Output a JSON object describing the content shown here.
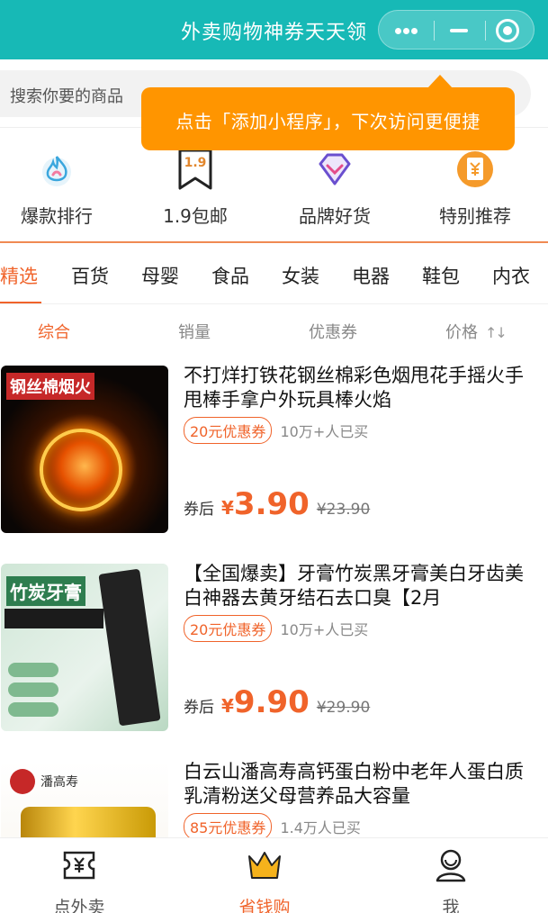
{
  "header": {
    "title": "外卖购物神券天天领"
  },
  "search": {
    "placeholder": "搜索你要的商品"
  },
  "tooltip": {
    "text": "点击「添加小程序」，下次访问更便捷"
  },
  "quick_nav": [
    {
      "label": "爆款排行",
      "icon": "flame-icon"
    },
    {
      "label": "1.9包邮",
      "icon": "bookmark-tag-icon",
      "badge": "1.9"
    },
    {
      "label": "品牌好货",
      "icon": "diamond-icon"
    },
    {
      "label": "特别推荐",
      "icon": "coupon-ticket-icon"
    }
  ],
  "categories": [
    "精选",
    "百货",
    "母婴",
    "食品",
    "女装",
    "电器",
    "鞋包",
    "内衣"
  ],
  "active_category": "精选",
  "sort": {
    "options": [
      "综合",
      "销量",
      "优惠券",
      "价格"
    ],
    "active": "综合"
  },
  "products": [
    {
      "title": "不打烊打铁花钢丝棉彩色烟甩花手摇火手甩棒手拿户外玩具棒火焰",
      "coupon": "20元优惠券",
      "sold": "10万+人已买",
      "after_label": "券后",
      "currency": "¥",
      "price": "3.90",
      "original_price": "¥23.90",
      "image_text": "钢丝棉烟火"
    },
    {
      "title": "【全国爆卖】牙膏竹炭黑牙膏美白牙齿美白神器去黄牙结石去口臭【2月",
      "coupon": "20元优惠券",
      "sold": "10万+人已买",
      "after_label": "券后",
      "currency": "¥",
      "price": "9.90",
      "original_price": "¥29.90",
      "image_text": "竹炭牙膏"
    },
    {
      "title": "白云山潘高寿高钙蛋白粉中老年人蛋白质乳清粉送父母营养品大容量",
      "coupon": "85元优惠券",
      "sold": "1.4万人已买",
      "image_text": "潘高寿"
    }
  ],
  "tabbar": [
    {
      "label": "点外卖",
      "icon": "ticket-yen-icon"
    },
    {
      "label": "省钱购",
      "icon": "crown-icon",
      "active": true
    },
    {
      "label": "我",
      "icon": "user-icon"
    }
  ],
  "colors": {
    "header_bg": "#17b9b6",
    "accent": "#f0632a",
    "tooltip_bg": "#ff9500"
  }
}
